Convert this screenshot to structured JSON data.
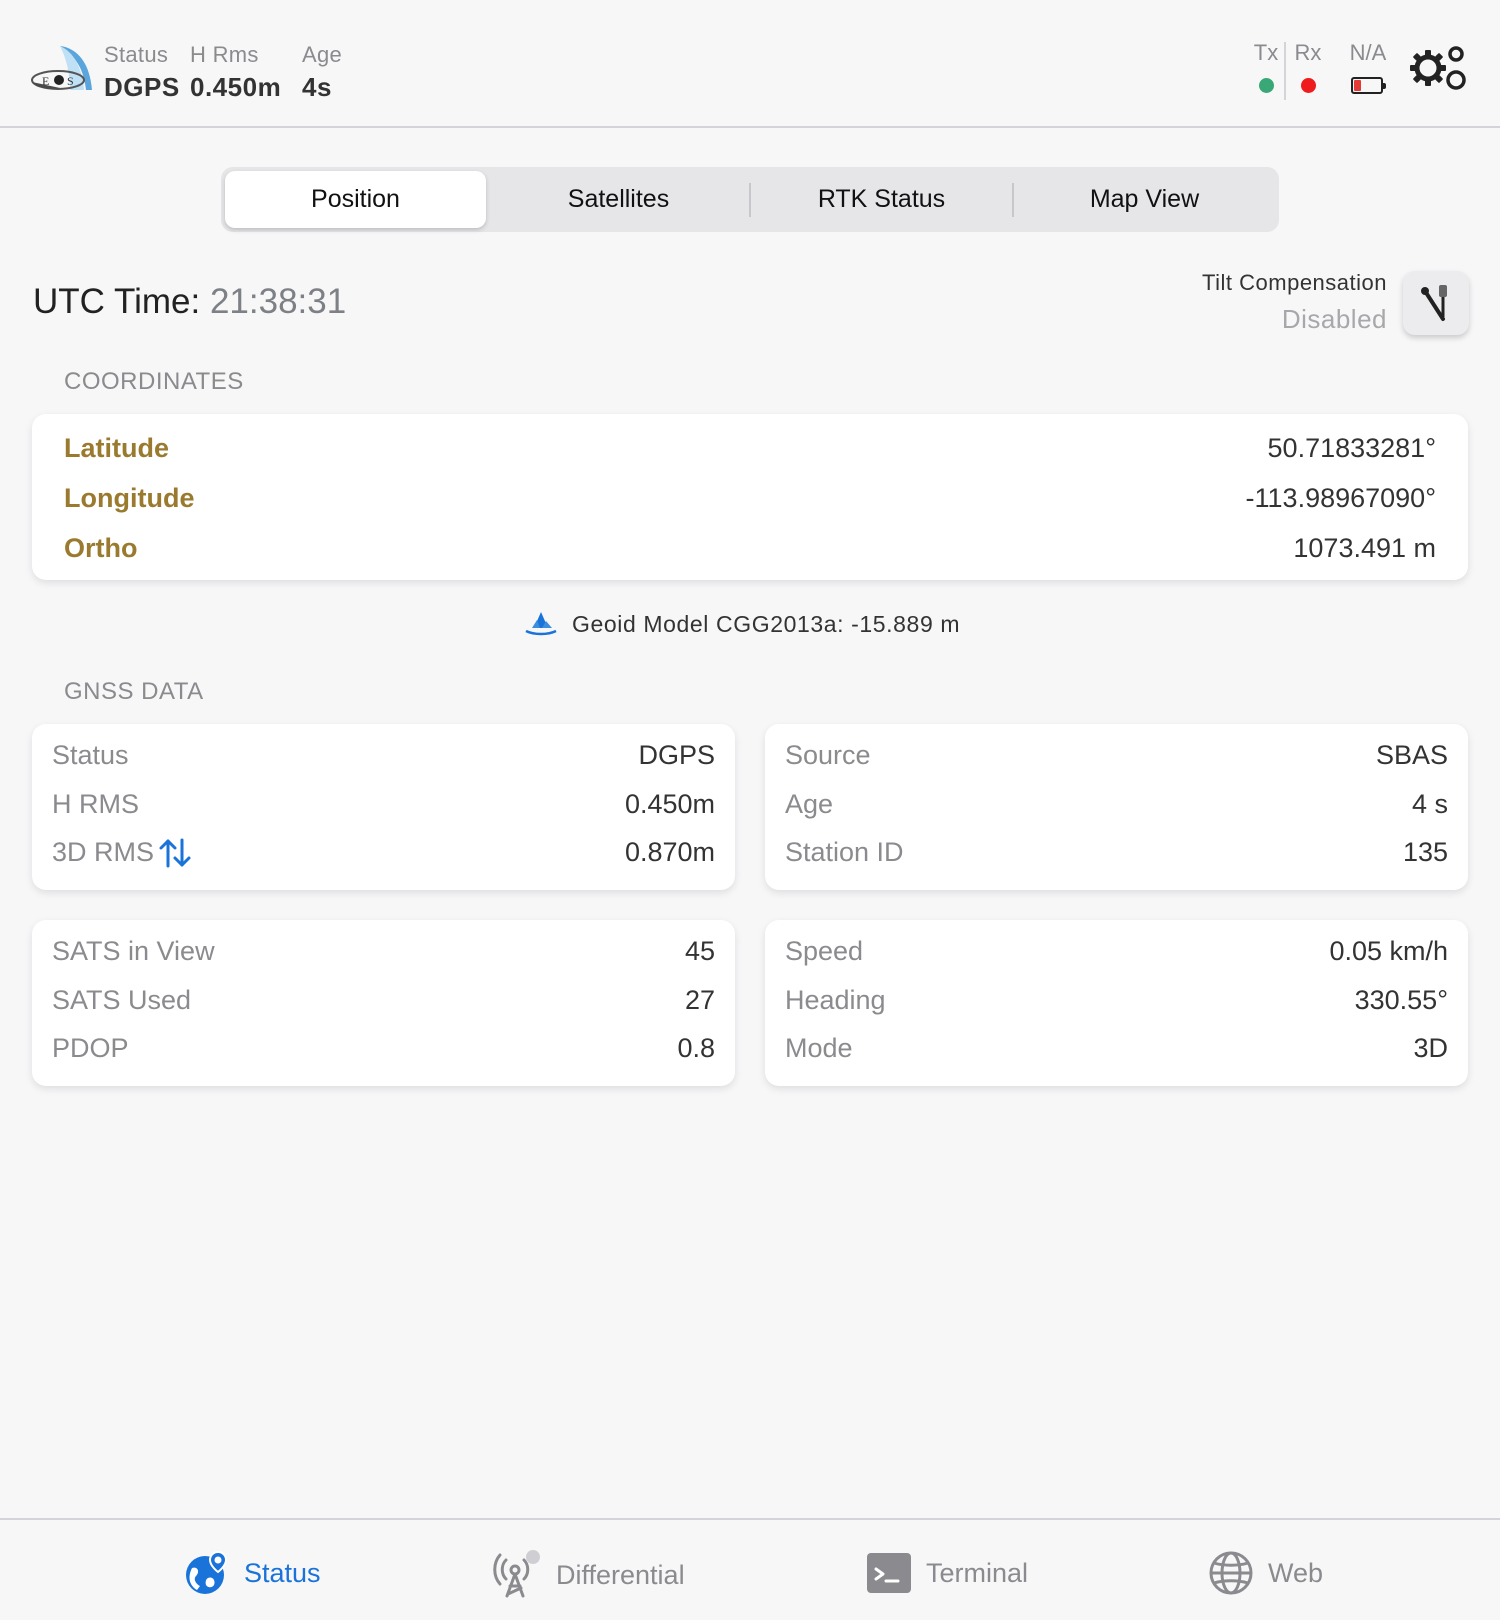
{
  "header": {
    "status_label": "Status",
    "status_value": "DGPS",
    "hrms_label": "H Rms",
    "hrms_value": "0.450m",
    "age_label": "Age",
    "age_value": "4s",
    "tx_label": "Tx",
    "rx_label": "Rx",
    "battery_label": "N/A",
    "tx_color": "#3aa776",
    "rx_color": "#ee1c1c"
  },
  "tabs": [
    {
      "label": "Position",
      "active": true
    },
    {
      "label": "Satellites",
      "active": false
    },
    {
      "label": "RTK Status",
      "active": false
    },
    {
      "label": "Map View",
      "active": false
    }
  ],
  "utc": {
    "label": "UTC Time:",
    "value": "21:38:31"
  },
  "tilt": {
    "label": "Tilt Compensation",
    "state": "Disabled"
  },
  "coordinates": {
    "title": "COORDINATES",
    "rows": [
      {
        "label": "Latitude",
        "value": "50.71833281°"
      },
      {
        "label": "Longitude",
        "value": "-113.98967090°"
      },
      {
        "label": "Ortho",
        "value": "1073.491 m"
      }
    ]
  },
  "geoid": {
    "text": "Geoid Model CGG2013a: -15.889 m"
  },
  "gnss": {
    "title": "GNSS DATA",
    "card1": [
      {
        "label": "Status",
        "value": "DGPS"
      },
      {
        "label": "H RMS",
        "value": "0.450m"
      },
      {
        "label": "3D RMS",
        "value": "0.870m"
      }
    ],
    "card2": [
      {
        "label": "Source",
        "value": "SBAS"
      },
      {
        "label": "Age",
        "value": "4 s"
      },
      {
        "label": "Station ID",
        "value": "135"
      }
    ],
    "card3": [
      {
        "label": "SATS in View",
        "value": "45"
      },
      {
        "label": "SATS Used",
        "value": "27"
      },
      {
        "label": "PDOP",
        "value": "0.8"
      }
    ],
    "card4": [
      {
        "label": "Speed",
        "value": "0.05 km/h"
      },
      {
        "label": "Heading",
        "value": "330.55°"
      },
      {
        "label": "Mode",
        "value": "3D"
      }
    ]
  },
  "bottom_nav": [
    {
      "label": "Status",
      "icon": "globe-pin-icon",
      "active": true
    },
    {
      "label": "Differential",
      "icon": "antenna-tower-icon",
      "active": false
    },
    {
      "label": "Terminal",
      "icon": "terminal-icon",
      "active": false
    },
    {
      "label": "Web",
      "icon": "globe-icon",
      "active": false
    }
  ],
  "colors": {
    "accent": "#1a73d9",
    "label_gold": "#9a7a2e"
  }
}
